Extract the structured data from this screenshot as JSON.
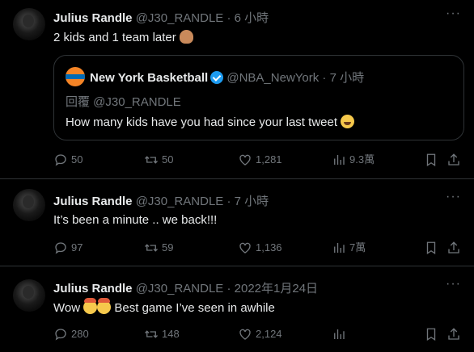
{
  "tweets": [
    {
      "name": "Julius Randle",
      "handle": "@J30_RANDLE",
      "separator": "·",
      "time": "6 小時",
      "text": "2 kids and 1 team later ",
      "emoji": "facepalm",
      "quote": {
        "name": "New York Basketball",
        "handle": "@NBA_NewYork",
        "separator": "·",
        "time": "7 小時",
        "reply_to": "回覆 @J30_RANDLE",
        "text": "How many kids have you had since your last tweet ",
        "emoji": "laugh"
      },
      "stats": {
        "replies": "50",
        "retweets": "50",
        "likes": "1,281",
        "views": "9.3萬"
      }
    },
    {
      "name": "Julius Randle",
      "handle": "@J30_RANDLE",
      "separator": "·",
      "time": "7 小時",
      "text": "It’s been a minute .. we back!!!",
      "stats": {
        "replies": "97",
        "retweets": "59",
        "likes": "1,136",
        "views": "7萬"
      }
    },
    {
      "name": "Julius Randle",
      "handle": "@J30_RANDLE",
      "separator": "·",
      "time": "2022年1月24日",
      "text_before": "Wow ",
      "text_after": " Best game I’ve seen in awhile",
      "emoji": "mind-blown",
      "stats": {
        "replies": "280",
        "retweets": "148",
        "likes": "2,124"
      }
    }
  ],
  "more_label": "···"
}
